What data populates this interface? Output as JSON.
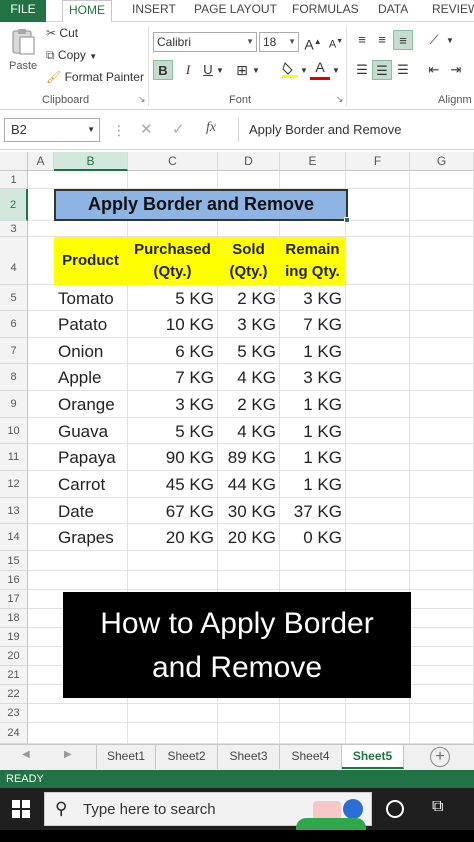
{
  "ribbon_tabs": [
    {
      "label": "FILE"
    },
    {
      "label": "HOME"
    },
    {
      "label": "INSERT"
    },
    {
      "label": "PAGE LAYOUT"
    },
    {
      "label": "FORMULAS"
    },
    {
      "label": "DATA"
    },
    {
      "label": "REVIEW"
    }
  ],
  "clipboard": {
    "paste_label": "Paste",
    "cut_label": "Cut",
    "copy_label": "Copy",
    "format_painter_label": "Format Painter",
    "group_label": "Clipboard"
  },
  "font": {
    "font_name": "Calibri",
    "font_size": "18",
    "grow_label": "A",
    "shrink_label": "A",
    "bold_label": "B",
    "italic_label": "I",
    "underline_label": "U",
    "font_color_label": "A",
    "group_label": "Font"
  },
  "alignment": {
    "group_label": "Alignm"
  },
  "formula_bar": {
    "name_box": "B2",
    "fx_label": "fx",
    "content": "Apply Border and Remove"
  },
  "columns": [
    "A",
    "B",
    "C",
    "D",
    "E",
    "F",
    "G"
  ],
  "rows": [
    "1",
    "2",
    "3",
    "4",
    "5",
    "6",
    "7",
    "8",
    "9",
    "10",
    "11",
    "12",
    "13",
    "14",
    "15",
    "16",
    "17",
    "18",
    "19",
    "20",
    "21",
    "22",
    "23",
    "24"
  ],
  "title_cell": "Apply Border and Remove",
  "table": {
    "headers": [
      {
        "line1": "Product",
        "line2": ""
      },
      {
        "line1": "Purchased",
        "line2": "(Qty.)"
      },
      {
        "line1": "Sold",
        "line2": "(Qty.)"
      },
      {
        "line1": "Remain",
        "line2": "ing Qty."
      }
    ],
    "rows": [
      [
        "Tomato",
        "5 KG",
        "2 KG",
        "3 KG"
      ],
      [
        "Patato",
        "10 KG",
        "3 KG",
        "7 KG"
      ],
      [
        "Onion",
        "6 KG",
        "5 KG",
        "1 KG"
      ],
      [
        "Apple",
        "7 KG",
        "4 KG",
        "3 KG"
      ],
      [
        "Orange",
        "3 KG",
        "2 KG",
        "1 KG"
      ],
      [
        "Guava",
        "5 KG",
        "4 KG",
        "1 KG"
      ],
      [
        "Papaya",
        "90 KG",
        "89 KG",
        "1 KG"
      ],
      [
        "Carrot",
        "45 KG",
        "44 KG",
        "1 KG"
      ],
      [
        "Date",
        "67 KG",
        "30 KG",
        "37 KG"
      ],
      [
        "Grapes",
        "20 KG",
        "20 KG",
        "0 KG"
      ]
    ]
  },
  "overlay": {
    "line1": "How to Apply Border",
    "line2": "and Remove"
  },
  "sheet_tabs": [
    "Sheet1",
    "Sheet2",
    "Sheet3",
    "Sheet4",
    "Sheet5"
  ],
  "active_sheet": "Sheet5",
  "status_text": "READY",
  "taskbar": {
    "search_placeholder": "Type here to search"
  },
  "colors": {
    "accent": "#217346",
    "header_fill": "#ffff00",
    "title_fill": "#8db4e2"
  }
}
